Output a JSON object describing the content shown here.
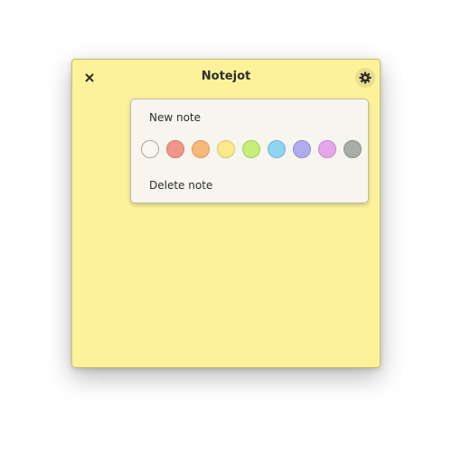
{
  "window": {
    "title": "Notejot"
  },
  "titlebar": {
    "close_icon": "close-icon",
    "settings_icon": "gear-icon"
  },
  "menu": {
    "new_note_label": "New note",
    "delete_note_label": "Delete note",
    "colors": [
      {
        "name": "white",
        "hex": "#f7f6f1",
        "border": "#a9a7a0"
      },
      {
        "name": "red",
        "hex": "#f2968a",
        "border": "#d97a6f"
      },
      {
        "name": "orange",
        "hex": "#f7b97a",
        "border": "#dd9d5e"
      },
      {
        "name": "yellow",
        "hex": "#fde98c",
        "border": "#dcc66a"
      },
      {
        "name": "green",
        "hex": "#c5ef7a",
        "border": "#a5cf5c"
      },
      {
        "name": "blue",
        "hex": "#90d4f1",
        "border": "#71b6d3"
      },
      {
        "name": "purple",
        "hex": "#b1abef",
        "border": "#918bd0"
      },
      {
        "name": "pink",
        "hex": "#e5a7ea",
        "border": "#c789cc"
      },
      {
        "name": "gray",
        "hex": "#a7aea8",
        "border": "#8a918b"
      }
    ]
  },
  "theme": {
    "note_background": "#fdf29a",
    "popover_background": "#f6f5ee"
  }
}
